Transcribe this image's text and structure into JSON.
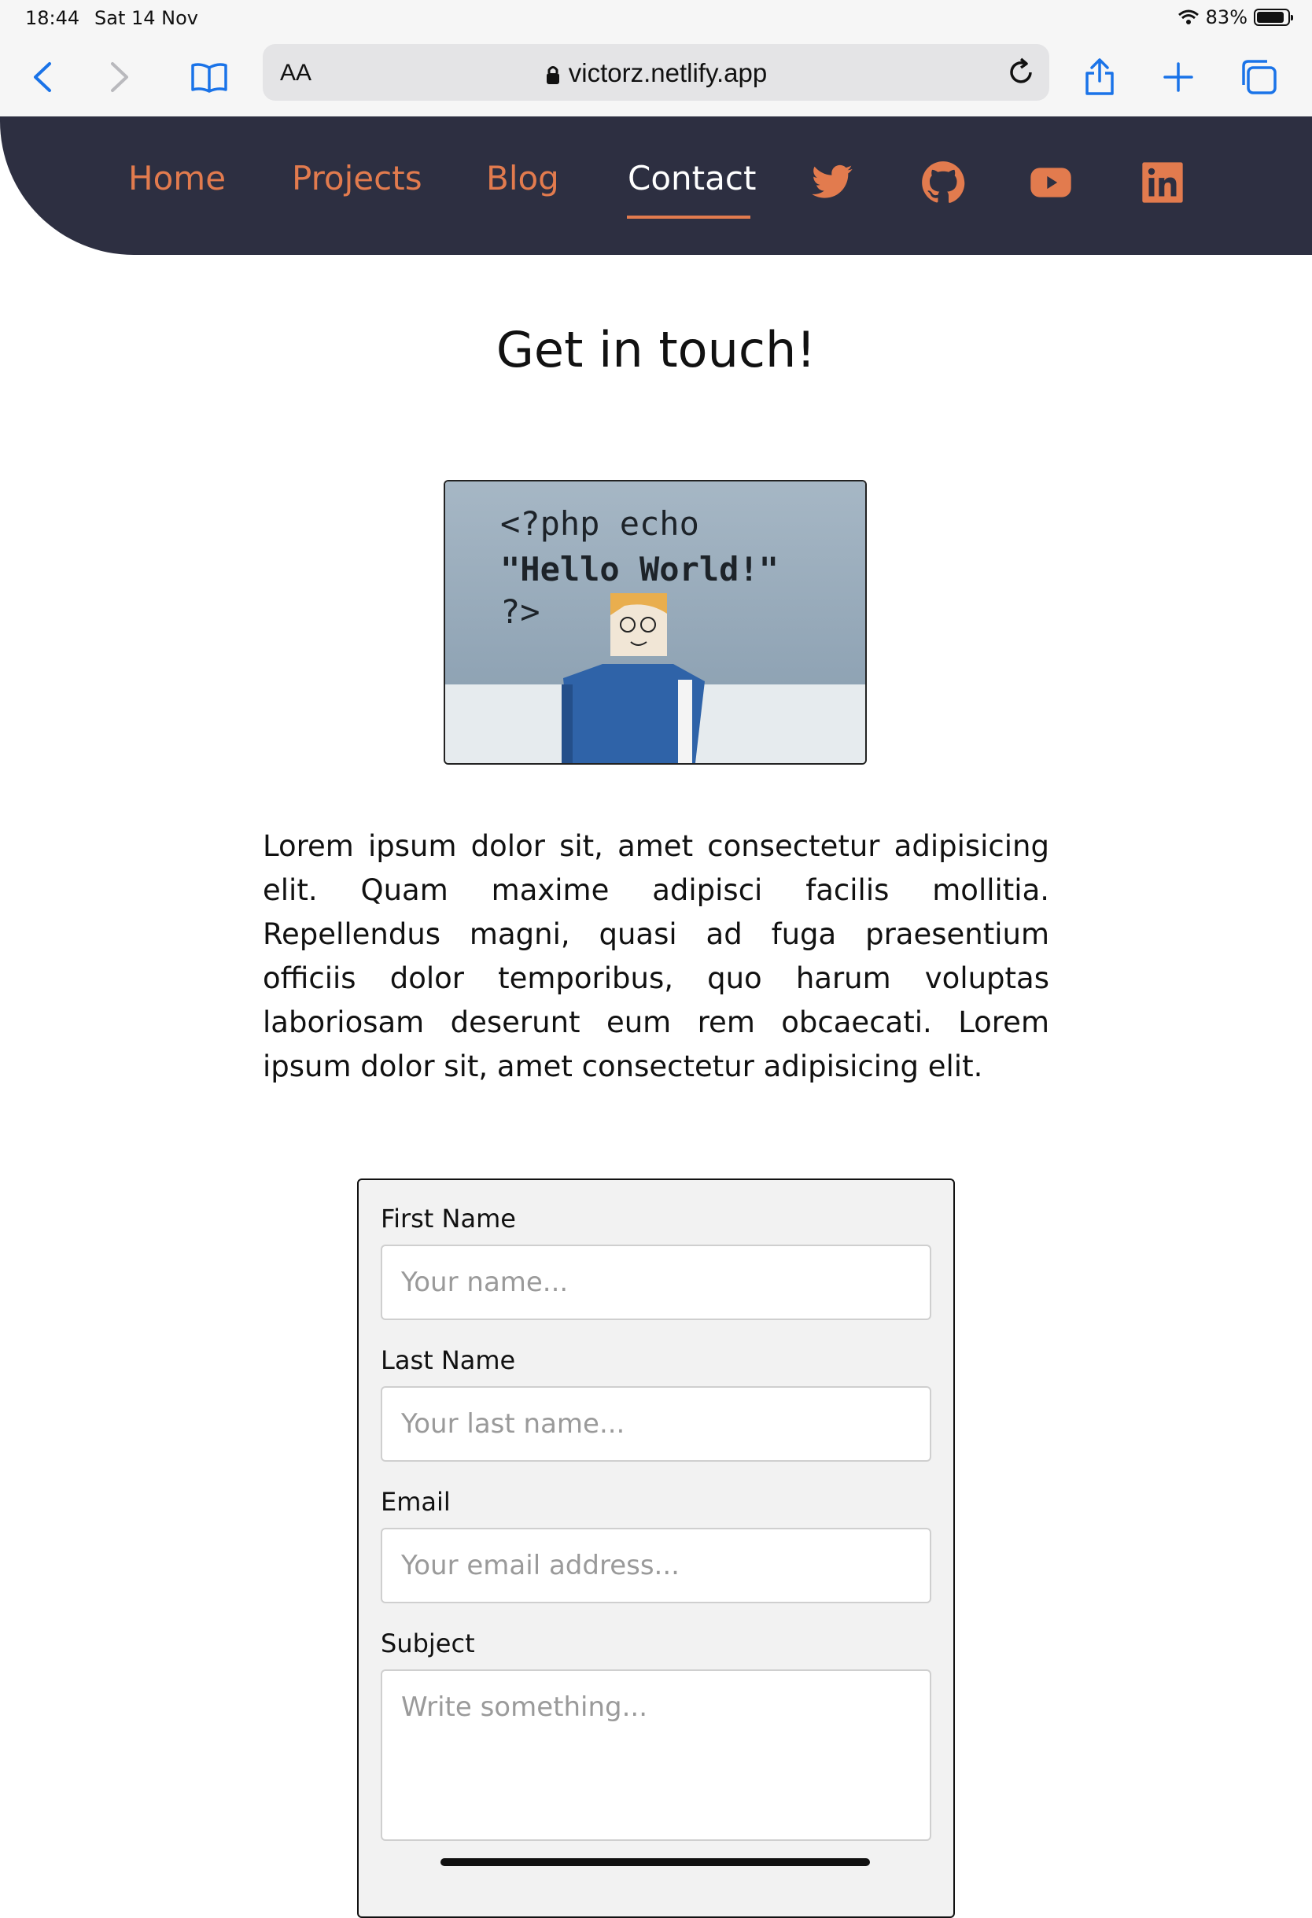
{
  "status_bar": {
    "time": "18:44",
    "date": "Sat 14 Nov",
    "battery": "83%"
  },
  "browser": {
    "text_size_label": "AA",
    "url": "victorz.netlify.app"
  },
  "nav": {
    "links": [
      "Home",
      "Projects",
      "Blog",
      "Contact"
    ],
    "active": "Contact",
    "social_icons": [
      "twitter-icon",
      "github-icon",
      "youtube-icon",
      "linkedin-icon"
    ],
    "accent_color": "#e27b4e",
    "background_color": "#2d2f41"
  },
  "page": {
    "title": "Get in touch!",
    "hero_image_text": [
      "<?php echo",
      "\"Hello World!\"",
      "?>"
    ],
    "paragraph": "Lorem ipsum dolor sit, amet consectetur adipisicing elit. Quam maxime adipisci facilis mollitia. Repellendus magni, quasi ad fuga praesentium officiis dolor temporibus, quo harum voluptas laboriosam deserunt eum rem obcaecati. Lorem ipsum dolor sit, amet consectetur adipisicing elit."
  },
  "form": {
    "first_name": {
      "label": "First Name",
      "placeholder": "Your name..."
    },
    "last_name": {
      "label": "Last Name",
      "placeholder": "Your last name..."
    },
    "email": {
      "label": "Email",
      "placeholder": "Your email address..."
    },
    "subject": {
      "label": "Subject",
      "placeholder": "Write something..."
    }
  }
}
